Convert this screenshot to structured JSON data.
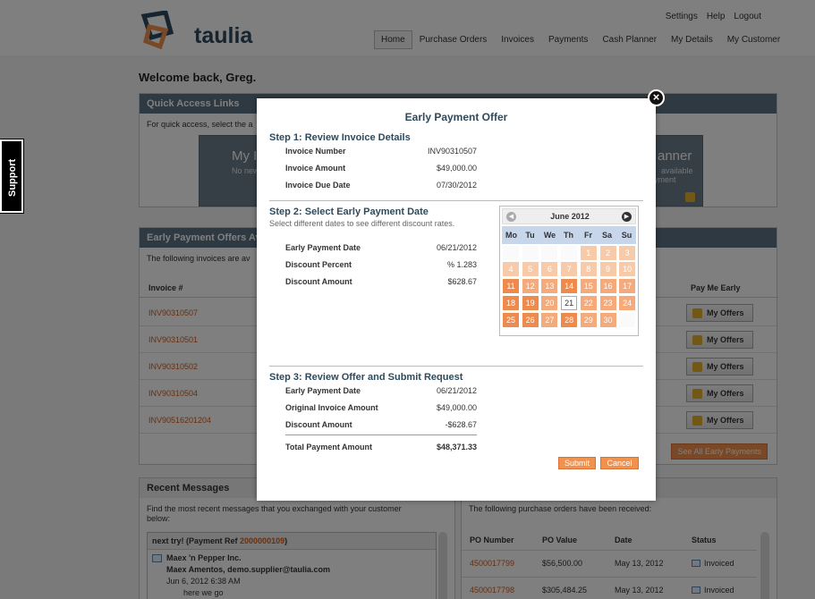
{
  "brand": {
    "name": "taulia"
  },
  "util_nav": [
    "Settings",
    "Help",
    "Logout"
  ],
  "main_nav": [
    {
      "label": "Home",
      "active": true
    },
    {
      "label": "Purchase Orders"
    },
    {
      "label": "Invoices"
    },
    {
      "label": "Payments"
    },
    {
      "label": "Cash Planner"
    },
    {
      "label": "My Details"
    },
    {
      "label": "My Customer"
    }
  ],
  "welcome": "Welcome back, Greg.",
  "support_tab": "Support",
  "quick_access": {
    "title": "Quick Access Links",
    "text": "For quick access, select the a",
    "tile_left": {
      "title": "My I",
      "sub": "No new"
    },
    "tile_right": {
      "title": "anner",
      "sub1": "available",
      "sub2": "yment"
    }
  },
  "offers_panel": {
    "title": "Early Payment Offers Av",
    "text": "The following invoices are av",
    "col_invoice": "Invoice #",
    "col_pay": "Pay Me Early",
    "rows": [
      "INV90310507",
      "INV90310501",
      "INV90310502",
      "INV90310504",
      "INV90516201204"
    ],
    "offer_button": "My Offers",
    "see_all": "See All Early Payments"
  },
  "messages_panel": {
    "title": "Recent Messages",
    "text1": "Find the most recent messages that you exchanged with your customer",
    "text2": "below:",
    "msg_head": "next try! (Payment Ref ",
    "msg_ref": "2000000109",
    "msg_head_end": ")",
    "sender": "Maex 'n Pepper Inc.",
    "from": "Maex Amentos, demo.supplier@taulia.com",
    "date": "Jun 6, 2012 6:38 AM",
    "preview": "here we go"
  },
  "po_panel": {
    "text": "The following purchase orders have been received:",
    "cols": [
      "PO Number",
      "PO Value",
      "Date",
      "Status"
    ],
    "rows": [
      {
        "num": "4500017799",
        "value": "$56,500.00",
        "date": "May 13, 2012",
        "status": "Invoiced"
      },
      {
        "num": "4500017798",
        "value": "$305,484.25",
        "date": "May 13, 2012",
        "status": "Invoiced"
      }
    ]
  },
  "modal": {
    "title": "Early Payment Offer",
    "close": "×",
    "step1": {
      "title": "Step 1: Review Invoice Details",
      "rows": [
        {
          "k": "Invoice Number",
          "v": "INV90310507"
        },
        {
          "k": "Invoice Amount",
          "v": "$49,000.00"
        },
        {
          "k": "Invoice Due Date",
          "v": "07/30/2012"
        }
      ]
    },
    "step2": {
      "title": "Step 2: Select Early Payment Date",
      "hint": "Select different dates to see different discount rates.",
      "rows": [
        {
          "k": "Early Payment Date",
          "v": "06/21/2012"
        },
        {
          "k": "Discount Percent",
          "v": "% 1.283"
        },
        {
          "k": "Discount Amount",
          "v": "$628.67"
        }
      ]
    },
    "step3": {
      "title": "Step 3: Review Offer and Submit Request",
      "rows": [
        {
          "k": "Early Payment Date",
          "v": "06/21/2012"
        },
        {
          "k": "Original Invoice Amount",
          "v": "$49,000.00"
        },
        {
          "k": "Discount Amount",
          "v": "-$628.67"
        }
      ],
      "total_k": "Total Payment Amount",
      "total_v": "$48,371.33"
    },
    "submit": "Submit",
    "cancel": "Cancel",
    "calendar": {
      "month": "June 2012",
      "dow": [
        "Mo",
        "Tu",
        "We",
        "Th",
        "Fr",
        "Sa",
        "Su"
      ],
      "selected_day": 21,
      "colors": {
        "light": "#f7cba9",
        "medium": "#f4aa7a",
        "dark": "#ee8a4c",
        "header": "#c7d6ea"
      }
    }
  }
}
